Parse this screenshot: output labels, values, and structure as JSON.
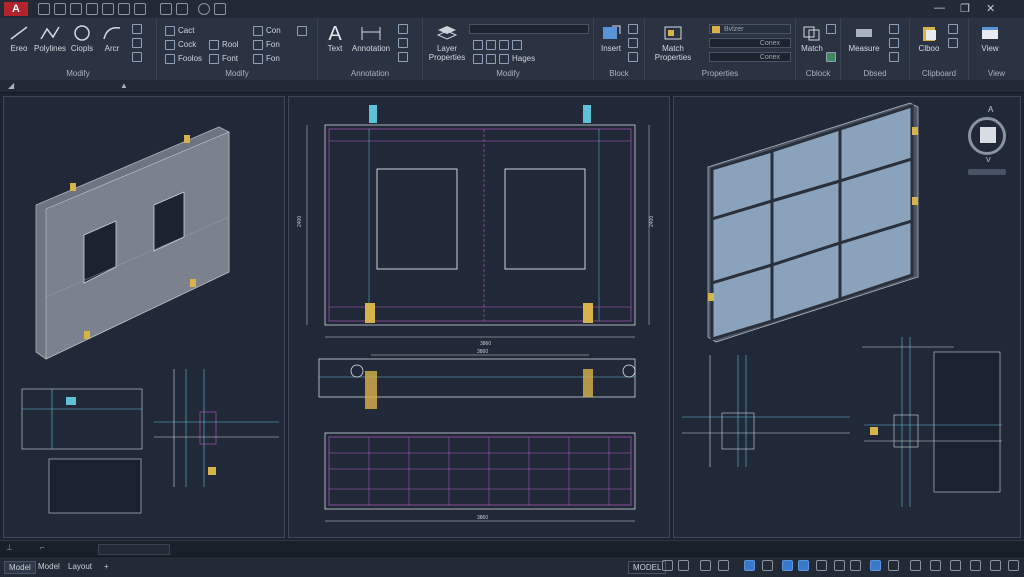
{
  "app": {
    "logo": "A"
  },
  "ribbon": {
    "draw_tools": [
      "Ereo",
      "Polylines",
      "Ciopls",
      "Arcr"
    ],
    "modify_small": [
      [
        "Cact",
        "Fan"
      ],
      [
        "Cock",
        "Roat",
        "Fon"
      ],
      [
        "Foolos",
        "Font",
        "Fon"
      ]
    ],
    "modify_small_flat": [
      "Cact",
      "Cock",
      "Rool",
      "Foolos",
      "Font",
      "Con",
      "Fon",
      "Fon"
    ],
    "panels": {
      "draw": "Modify",
      "modify": "Modify",
      "annotation": "Annotation",
      "modify2": "Modify",
      "block": "Block",
      "properties": "Properties",
      "cblock": "Cblock",
      "dbsed": "Dbsed",
      "clipboard": "Clipboard",
      "view": "View"
    },
    "annotation_tools": [
      "Text",
      "Annotation"
    ],
    "layer_tool": [
      "Layer",
      "Properties"
    ],
    "layer_combo": "",
    "hages": "Hages",
    "insert": "Insert",
    "match_properties": [
      "Match",
      "Properties"
    ],
    "combo_bylayer": "Bvlzer",
    "combo_2": "Conex",
    "combo_3": "Conex",
    "match": "Match",
    "measure": "Measure",
    "clboo": "Clboo",
    "view": "View"
  },
  "nav": {
    "cube_top": "A",
    "cube_bottom": "V"
  },
  "drawing": {
    "dim_top": "3860",
    "dim_mid": "3860",
    "dim_bottom": "3860",
    "dim_left": "2400",
    "dim_right": "2400"
  },
  "status": {
    "model_tab": "Model",
    "model_tab2": "Model",
    "layout_tab": "Layout",
    "mode_label": "MODEL"
  },
  "colors": {
    "accent": "#3a78c9",
    "magenta_line": "#c05ac8",
    "cyan_line": "#5fc2d8",
    "yellow": "#d8b24a",
    "glass": "#8aa2bb"
  }
}
